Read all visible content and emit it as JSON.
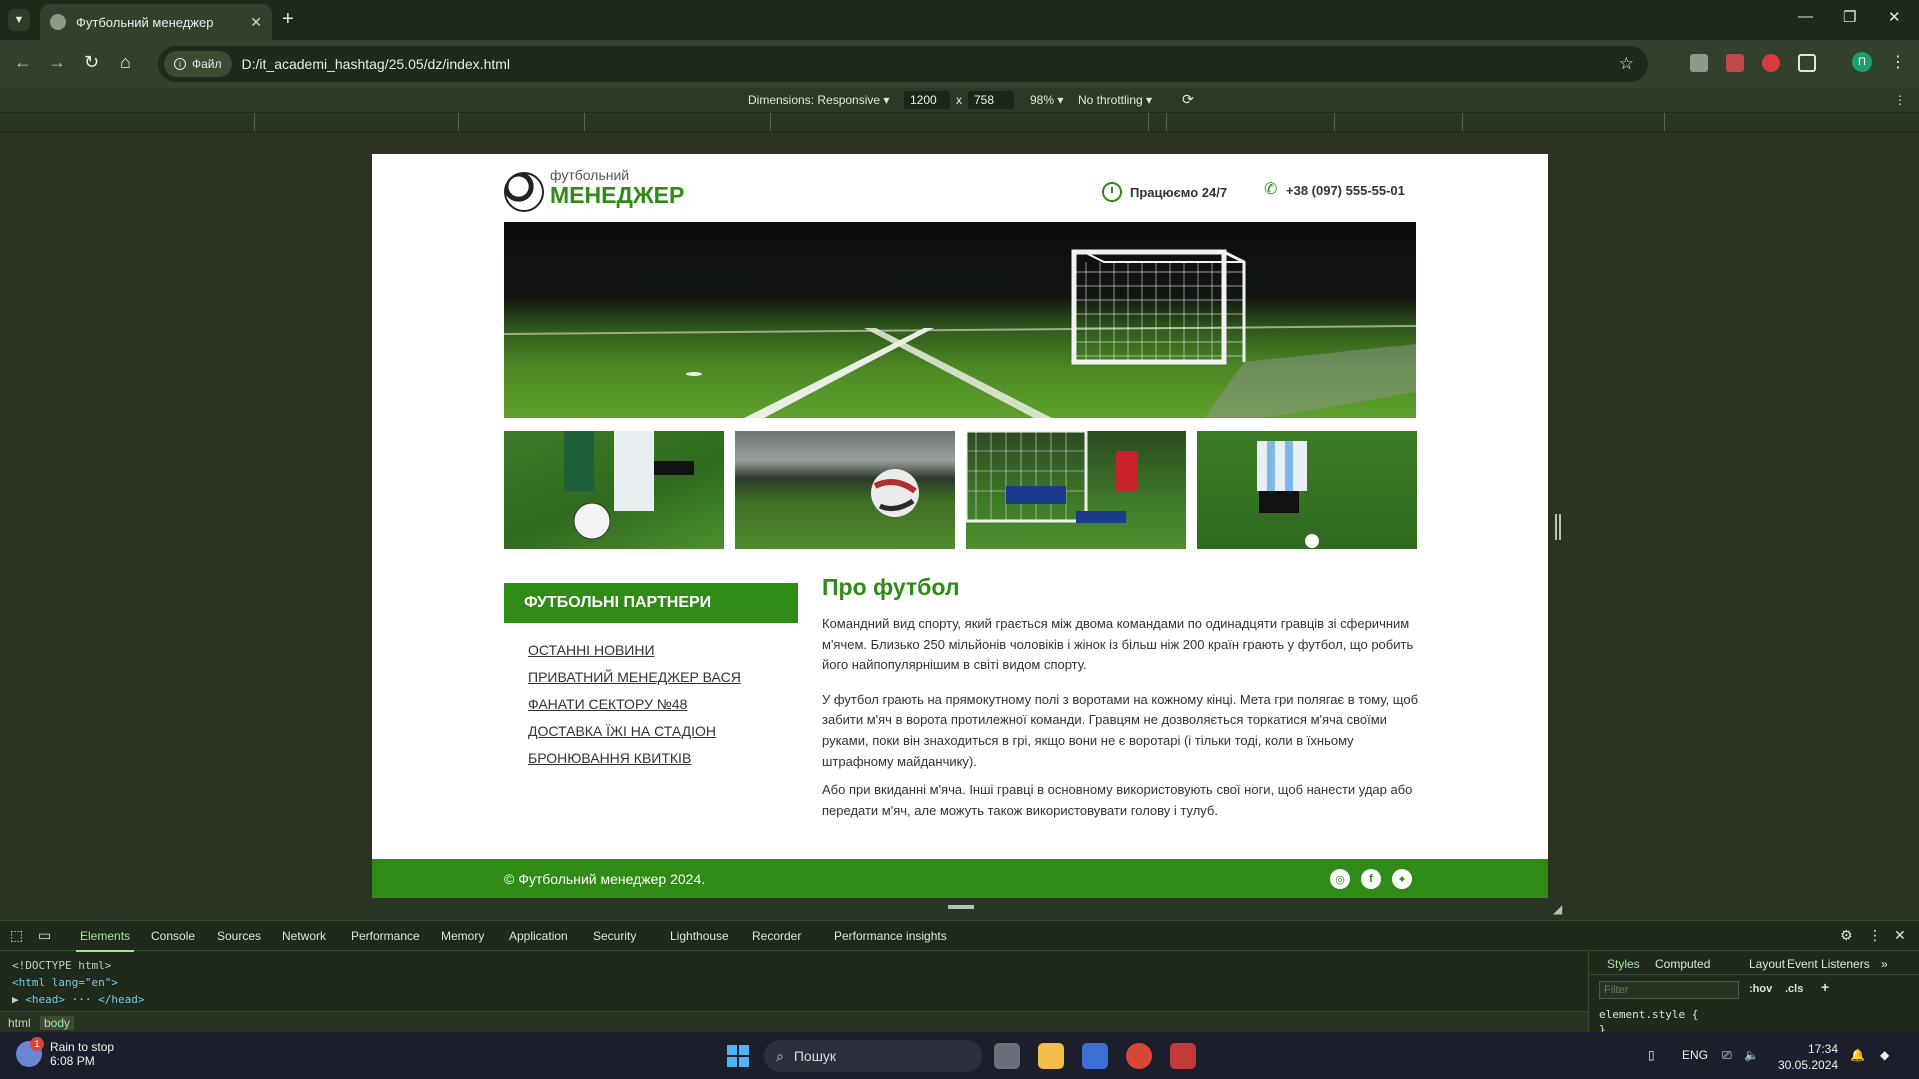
{
  "browser": {
    "tab_title": "Футбольний менеджер",
    "site_chip": "Файл",
    "url": "D:/it_academi_hashtag/25.05/dz/index.html",
    "profile_initial": "П"
  },
  "device_toolbar": {
    "dimensions": "Dimensions: Responsive",
    "width": "1200",
    "times": "x",
    "height": "758",
    "zoom": "98%",
    "throttling": "No throttling"
  },
  "site": {
    "brand_small": "футбольний",
    "brand_big": "МЕНЕДЖЕР",
    "hours": "Працюємо 24/7",
    "phone": "+38 (097) 555-55-01",
    "partners_title": "ФУТБОЛЬНІ ПАРТНЕРИ",
    "partners": [
      "ОСТАННІ НОВИНИ",
      "ПРИВАТНИЙ МЕНЕДЖЕР ВАСЯ",
      "ФАНАТИ СЕКТОРУ №48",
      "ДОСТАВКА ЇЖІ НА СТАДІОН",
      "БРОНЮВАННЯ КВИТКІВ"
    ],
    "about_title": "Про футбол",
    "about_paragraphs": [
      "Командний вид спорту, який грається між двома командами по одинадцяти гравців зі сферичним м'ячем. Близько 250 мільйонів чоловіків і жінок із більш ніж 200 країн грають у футбол, що робить його найпопулярнішим в світі видом спорту.",
      "У футбол грають на прямокутному полі з воротами на кожному кінці. Мета гри полягає в тому, щоб забити м'яч в ворота протилежної команди. Гравцям не дозволяється торкатися м'яча своїми руками, поки він знаходиться в грі, якщо вони не є воротарі (і тільки тоді, коли в їхньому штрафному майданчику).",
      "Або при вкиданні м'яча. Інші гравці в основному використовують свої ноги, щоб нанести удар або передати м'яч, але можуть також використовувати голову і тулуб."
    ],
    "footer": "© Футбольний менеджер 2024.",
    "accent_color": "#2f8a16"
  },
  "devtools": {
    "tabs": [
      "Elements",
      "Console",
      "Sources",
      "Network",
      "Performance",
      "Memory",
      "Application",
      "Security",
      "Lighthouse",
      "Recorder",
      "Performance insights"
    ],
    "code_lines": [
      "<!DOCTYPE html>",
      "<html lang=\"en\">",
      "<head>",
      "</head>"
    ],
    "crumbs": [
      "html",
      "body"
    ],
    "styles_tabs": [
      "Styles",
      "Computed",
      "Layout",
      "Event Listeners"
    ],
    "filter_placeholder": "Filter",
    "hov": ":hov",
    "cls": ".cls",
    "element_style": "element.style {",
    "element_style_close": "}"
  },
  "taskbar": {
    "weather_title": "Rain to stop",
    "weather_time": "6:08 PM",
    "weather_badge": "1",
    "search_placeholder": "Пошук",
    "lang": "ENG",
    "time": "17:34",
    "date": "30.05.2024"
  }
}
